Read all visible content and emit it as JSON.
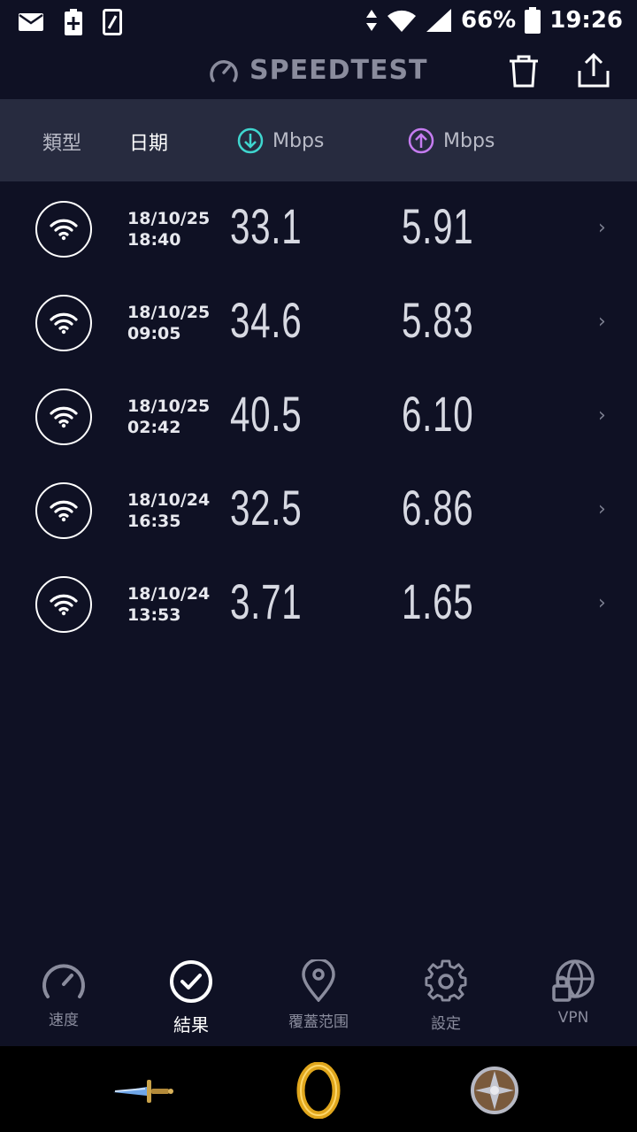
{
  "status_bar": {
    "battery": "66%",
    "time": "19:26"
  },
  "app": {
    "title": "SPEEDTEST"
  },
  "columns": {
    "type": "類型",
    "date": "日期",
    "download_unit": "Mbps",
    "upload_unit": "Mbps"
  },
  "results": [
    {
      "date": "18/10/25",
      "time": "18:40",
      "download": "33.1",
      "upload": "5.91"
    },
    {
      "date": "18/10/25",
      "time": "09:05",
      "download": "34.6",
      "upload": "5.83"
    },
    {
      "date": "18/10/25",
      "time": "02:42",
      "download": "40.5",
      "upload": "6.10"
    },
    {
      "date": "18/10/24",
      "time": "16:35",
      "download": "32.5",
      "upload": "6.86"
    },
    {
      "date": "18/10/24",
      "time": "13:53",
      "download": "3.71",
      "upload": "1.65"
    }
  ],
  "nav": [
    {
      "label": "速度",
      "icon": "speedometer-icon"
    },
    {
      "label": "結果",
      "icon": "check-circle-icon"
    },
    {
      "label": "覆蓋范围",
      "icon": "map-pin-icon"
    },
    {
      "label": "設定",
      "icon": "gear-icon"
    },
    {
      "label": "VPN",
      "icon": "vpn-lock-icon"
    }
  ],
  "dock": [
    {
      "icon": "dagger-app-icon"
    },
    {
      "icon": "ring-app-icon"
    },
    {
      "icon": "shield-app-icon"
    }
  ],
  "colors": {
    "background": "#0f1124",
    "header_bar": "#272b3f",
    "download_accent": "#3fd6cf",
    "upload_accent": "#c57cf0"
  }
}
